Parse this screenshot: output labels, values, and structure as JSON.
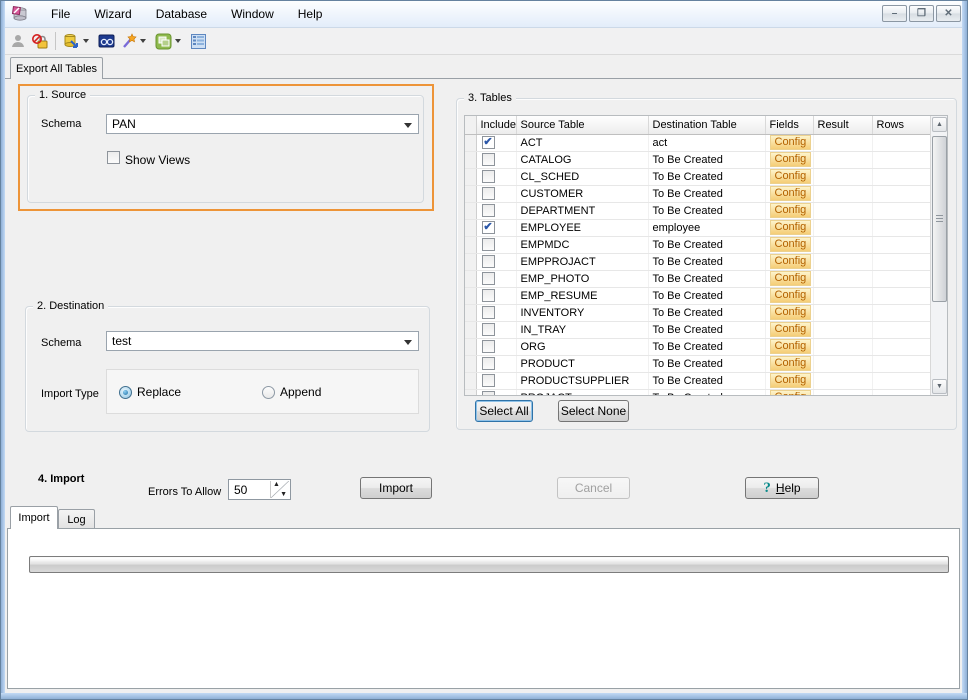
{
  "window": {
    "controls": [
      {
        "name": "minimize",
        "glyph": "–"
      },
      {
        "name": "restore",
        "glyph": "❐"
      },
      {
        "name": "close",
        "glyph": "✕"
      }
    ]
  },
  "menubar": {
    "items": [
      "File",
      "Wizard",
      "Database",
      "Window",
      "Help"
    ]
  },
  "toolbar": {
    "icons": [
      "user-icon",
      "disconnect-lock-icon",
      "export-database-icon",
      "export-dropdown-arrow",
      "sql-monitor-icon",
      "wizard-wand-icon",
      "wizard-dropdown-arrow",
      "windows-cascade-icon",
      "windows-dropdown-arrow",
      "grid-list-icon"
    ]
  },
  "main_tab": {
    "label": "Export All Tables"
  },
  "source": {
    "title": "1. Source",
    "schema_label": "Schema",
    "schema_value": "PAN",
    "show_views_label": "Show Views",
    "show_views_checked": false,
    "highlight_color": "#ED9438"
  },
  "destination": {
    "title": "2. Destination",
    "schema_label": "Schema",
    "schema_value": "test",
    "import_type_label": "Import Type",
    "options": [
      {
        "label": "Replace",
        "selected": true
      },
      {
        "label": "Append",
        "selected": false
      }
    ]
  },
  "tables": {
    "title": "3. Tables",
    "columns": [
      "Include",
      "Source Table",
      "Destination Table",
      "Fields",
      "Result",
      "Rows"
    ],
    "config_label": "Config",
    "config_color": "#B36200",
    "select_all_label": "Select All",
    "select_none_label": "Select None",
    "rows": [
      {
        "included": true,
        "source": "ACT",
        "destination": "act",
        "fields": "Config",
        "result": "",
        "rows": ""
      },
      {
        "included": false,
        "source": "CATALOG",
        "destination": "To Be Created",
        "fields": "Config",
        "result": "",
        "rows": ""
      },
      {
        "included": false,
        "source": "CL_SCHED",
        "destination": "To Be Created",
        "fields": "Config",
        "result": "",
        "rows": ""
      },
      {
        "included": false,
        "source": "CUSTOMER",
        "destination": "To Be Created",
        "fields": "Config",
        "result": "",
        "rows": ""
      },
      {
        "included": false,
        "source": "DEPARTMENT",
        "destination": "To Be Created",
        "fields": "Config",
        "result": "",
        "rows": ""
      },
      {
        "included": true,
        "source": "EMPLOYEE",
        "destination": "employee",
        "fields": "Config",
        "result": "",
        "rows": ""
      },
      {
        "included": false,
        "source": "EMPMDC",
        "destination": "To Be Created",
        "fields": "Config",
        "result": "",
        "rows": ""
      },
      {
        "included": false,
        "source": "EMPPROJACT",
        "destination": "To Be Created",
        "fields": "Config",
        "result": "",
        "rows": ""
      },
      {
        "included": false,
        "source": "EMP_PHOTO",
        "destination": "To Be Created",
        "fields": "Config",
        "result": "",
        "rows": ""
      },
      {
        "included": false,
        "source": "EMP_RESUME",
        "destination": "To Be Created",
        "fields": "Config",
        "result": "",
        "rows": ""
      },
      {
        "included": false,
        "source": "INVENTORY",
        "destination": "To Be Created",
        "fields": "Config",
        "result": "",
        "rows": ""
      },
      {
        "included": false,
        "source": "IN_TRAY",
        "destination": "To Be Created",
        "fields": "Config",
        "result": "",
        "rows": ""
      },
      {
        "included": false,
        "source": "ORG",
        "destination": "To Be Created",
        "fields": "Config",
        "result": "",
        "rows": ""
      },
      {
        "included": false,
        "source": "PRODUCT",
        "destination": "To Be Created",
        "fields": "Config",
        "result": "",
        "rows": ""
      },
      {
        "included": false,
        "source": "PRODUCTSUPPLIER",
        "destination": "To Be Created",
        "fields": "Config",
        "result": "",
        "rows": ""
      },
      {
        "included": false,
        "source": "PROJACT",
        "destination": "To Be Created",
        "fields": "Config",
        "result": "",
        "rows": ""
      }
    ]
  },
  "import_section": {
    "title": "4. Import",
    "errors_label": "Errors To Allow",
    "errors_value": "50",
    "import_label": "Import",
    "cancel_label": "Cancel",
    "help_label": "Help"
  },
  "bottom_tabs": {
    "items": [
      {
        "label": "Import",
        "active": true
      },
      {
        "label": "Log",
        "active": false
      }
    ]
  }
}
